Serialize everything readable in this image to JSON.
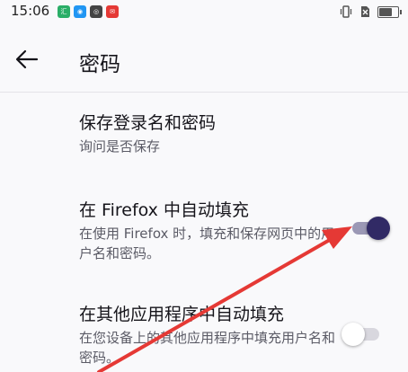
{
  "status": {
    "time": "15:06",
    "app_icons": [
      {
        "name": "wechat-work-icon",
        "color": "#2aae67",
        "glyph": "汇"
      },
      {
        "name": "browser-icon",
        "color": "#2196f3",
        "glyph": "◉"
      },
      {
        "name": "compass-icon",
        "color": "#444444",
        "glyph": "◎"
      },
      {
        "name": "red-app-icon",
        "color": "#e53935",
        "glyph": "✉"
      }
    ],
    "battery_level": 0.7
  },
  "header": {
    "title": "密码",
    "back_icon": "arrow-left-icon"
  },
  "settings": [
    {
      "title": "保存登录名和密码",
      "summary": "询问是否保存",
      "has_toggle": false
    },
    {
      "title": "在 Firefox 中自动填充",
      "summary": "在使用 Firefox 时，填充和保存网页中的用户名和密码。",
      "has_toggle": true,
      "toggle_on": true
    },
    {
      "title": "在其他应用程序中自动填充",
      "summary": "在您设备上的其他应用程序中填充用户名和密码。",
      "has_toggle": true,
      "toggle_on": false
    }
  ],
  "colors": {
    "toggle_on_thumb": "#312a65",
    "toggle_on_track": "#9b98b5",
    "toggle_off_thumb": "#ffffff",
    "toggle_off_track": "#d8d7de",
    "annotation_arrow": "#e53935"
  }
}
